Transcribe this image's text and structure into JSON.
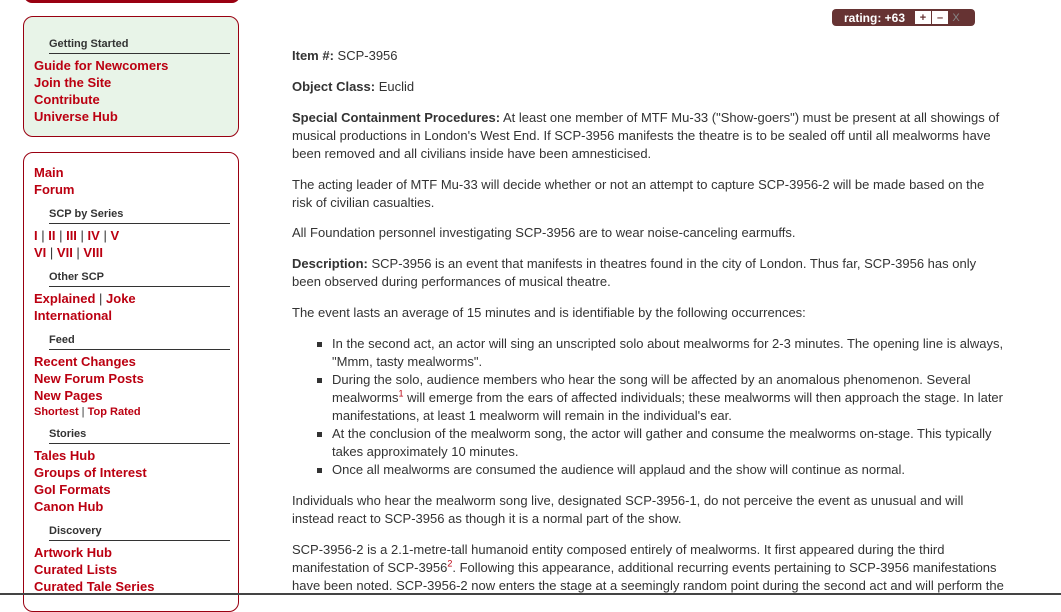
{
  "sidebar": {
    "getting_started": {
      "heading": "Getting Started",
      "links": [
        "Guide for Newcomers",
        "Join the Site",
        "Contribute",
        "Universe Hub"
      ]
    },
    "main_links": [
      "Main",
      "Forum"
    ],
    "scp_by_series": {
      "heading": "SCP by Series",
      "row1": [
        "I",
        "II",
        "III",
        "IV",
        "V"
      ],
      "row2": [
        "VI",
        "VII",
        "VIII"
      ]
    },
    "other_scp": {
      "heading": "Other SCP",
      "row1": [
        "Explained",
        "Joke"
      ],
      "row2": "International"
    },
    "feed": {
      "heading": "Feed",
      "links": [
        "Recent Changes",
        "New Forum Posts",
        "New Pages"
      ],
      "small": [
        "Shortest",
        "Top Rated"
      ]
    },
    "stories": {
      "heading": "Stories",
      "links": [
        "Tales Hub",
        "Groups of Interest",
        "GoI Formats",
        "Canon Hub"
      ]
    },
    "discovery": {
      "heading": "Discovery",
      "links": [
        "Artwork Hub",
        "Curated Lists",
        "Curated Tale Series"
      ]
    }
  },
  "rating": {
    "label": "rating: +63",
    "plus": "+",
    "minus": "–",
    "cancel": "X"
  },
  "article": {
    "item_label": "Item #:",
    "item_value": "SCP-3956",
    "class_label": "Object Class:",
    "class_value": "Euclid",
    "scp_label": "Special Containment Procedures:",
    "scp_text": "At least one member of MTF Mu-33 (\"Show-goers\") must be present at all showings of musical productions in London's West End. If SCP-3956 manifests the theatre is to be sealed off until all mealworms have been removed and all civilians inside have been amnesticised.",
    "p_acting": "The acting leader of MTF Mu-33 will decide whether or not an attempt to capture SCP-3956-2 will be made based on the risk of civilian casualties.",
    "p_personnel": "All Foundation personnel investigating SCP-3956 are to wear noise-canceling earmuffs.",
    "desc_label": "Description:",
    "desc_text": "SCP-3956 is an event that manifests in theatres found in the city of London. Thus far, SCP-3956 has only been observed during performances of musical theatre.",
    "p_event": "The event lasts an average of 15 minutes and is identifiable by the following occurrences:",
    "bullet1": "In the second act, an actor will sing an unscripted solo about mealworms for 2-3 minutes. The opening line is always, \"Mmm, tasty mealworms\".",
    "bullet2_a": "During the solo, audience members who hear the song will be affected by an anomalous phenomenon. Several mealworms",
    "bullet2_ref": "1",
    "bullet2_b": " will emerge from the ears of affected individuals; these mealworms will then approach the stage. In later manifestations, at least 1 mealworm will remain in the individual's ear.",
    "bullet3": "At the conclusion of the mealworm song, the actor will gather and consume the mealworms on-stage. This typically takes approximately 10 minutes.",
    "bullet4": "Once all mealworms are consumed the audience will applaud and the show will continue as normal.",
    "p_individuals": "Individuals who hear the mealworm song live, designated SCP-3956-1, do not perceive the event as unusual and will instead react to SCP-3956 as though it is a normal part of the show.",
    "p_entity_a": "SCP-3956-2 is a 2.1-metre-tall humanoid entity composed entirely of mealworms. It first appeared during the third manifestation of SCP-3956",
    "p_entity_ref": "2",
    "p_entity_b": ". Following this appearance, additional recurring events pertaining to SCP-3956 manifestations have been noted. SCP-3956-2 now enters the stage at a seemingly random point during the second act and will perform the"
  }
}
